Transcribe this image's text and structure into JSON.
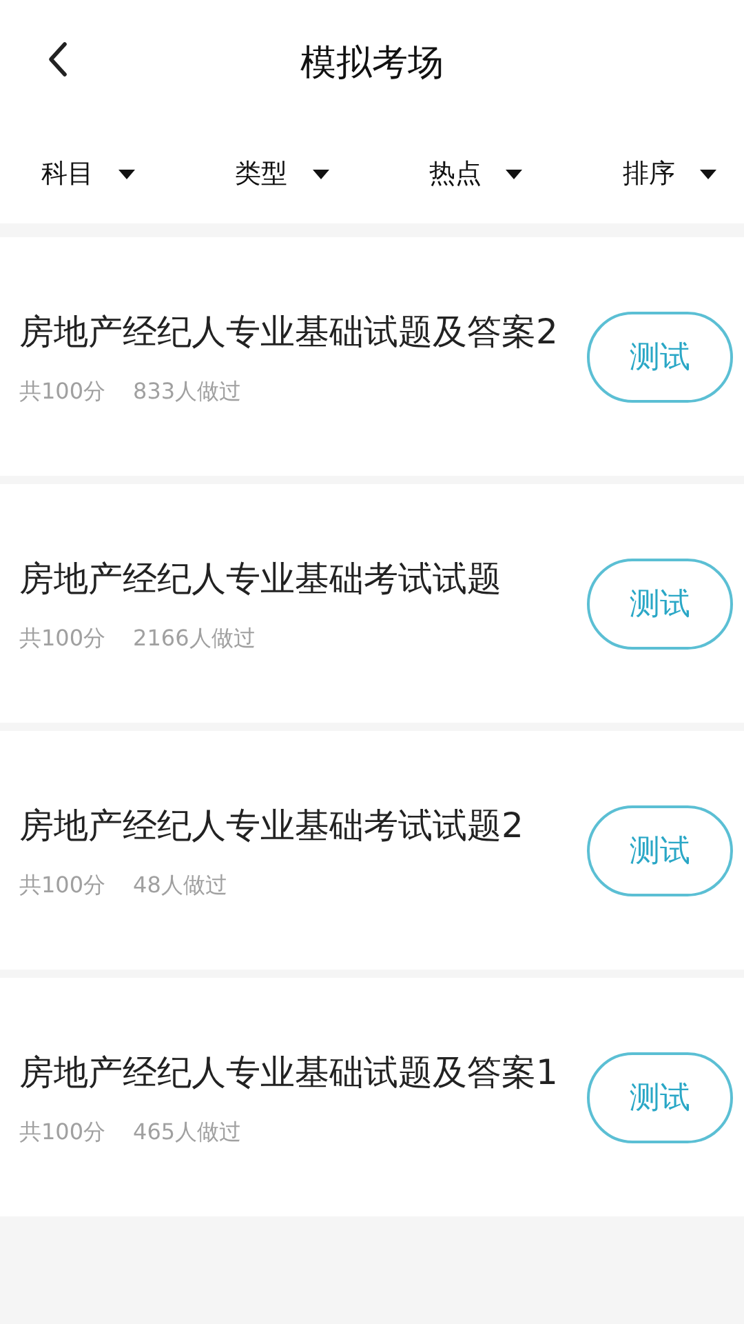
{
  "header": {
    "title": "模拟考场"
  },
  "filters": [
    {
      "label": "科目"
    },
    {
      "label": "类型"
    },
    {
      "label": "热点"
    },
    {
      "label": "排序"
    }
  ],
  "exams": [
    {
      "title": "房地产经纪人专业基础试题及答案2",
      "score": "共100分",
      "takers": "833人做过",
      "button": "测试"
    },
    {
      "title": "房地产经纪人专业基础考试试题",
      "score": "共100分",
      "takers": "2166人做过",
      "button": "测试"
    },
    {
      "title": "房地产经纪人专业基础考试试题2",
      "score": "共100分",
      "takers": "48人做过",
      "button": "测试"
    },
    {
      "title": "房地产经纪人专业基础试题及答案1",
      "score": "共100分",
      "takers": "465人做过",
      "button": "测试"
    }
  ]
}
